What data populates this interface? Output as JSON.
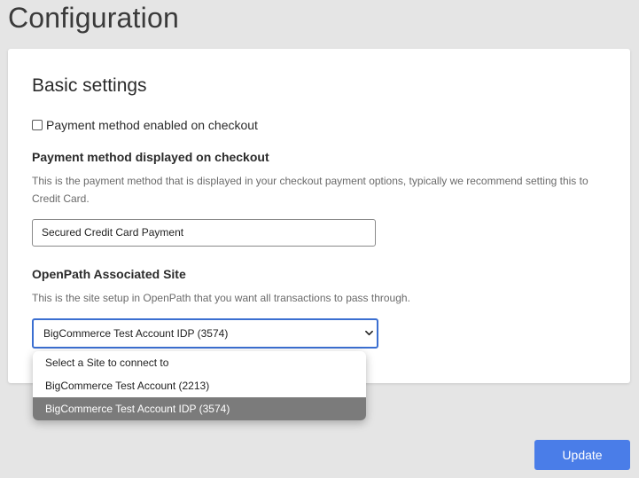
{
  "page": {
    "title": "Configuration"
  },
  "basic_settings": {
    "title": "Basic settings",
    "enabled_checkbox": {
      "label": "Payment method enabled on checkout",
      "checked": false
    },
    "display_name": {
      "label": "Payment method displayed on checkout",
      "help": "This is the payment method that is displayed in your checkout payment options, typically we recommend setting this to Credit Card.",
      "value": "Secured Credit Card Payment"
    },
    "associated_site": {
      "label": "OpenPath Associated Site",
      "help": "This is the site setup in OpenPath that you want all transactions to pass through.",
      "selected": "BigCommerce Test Account IDP (3574)",
      "options": [
        "Select a Site to connect to",
        "BigCommerce Test Account (2213)",
        "BigCommerce Test Account IDP (3574)"
      ]
    }
  },
  "actions": {
    "update_label": "Update"
  },
  "colors": {
    "accent": "#4a7de8",
    "focus_border": "#3b6fd1",
    "selected_option_bg": "#7b7b7b",
    "page_bg": "#e5e5e5"
  },
  "icons": {
    "select_chevron": "chevron-down-icon"
  }
}
